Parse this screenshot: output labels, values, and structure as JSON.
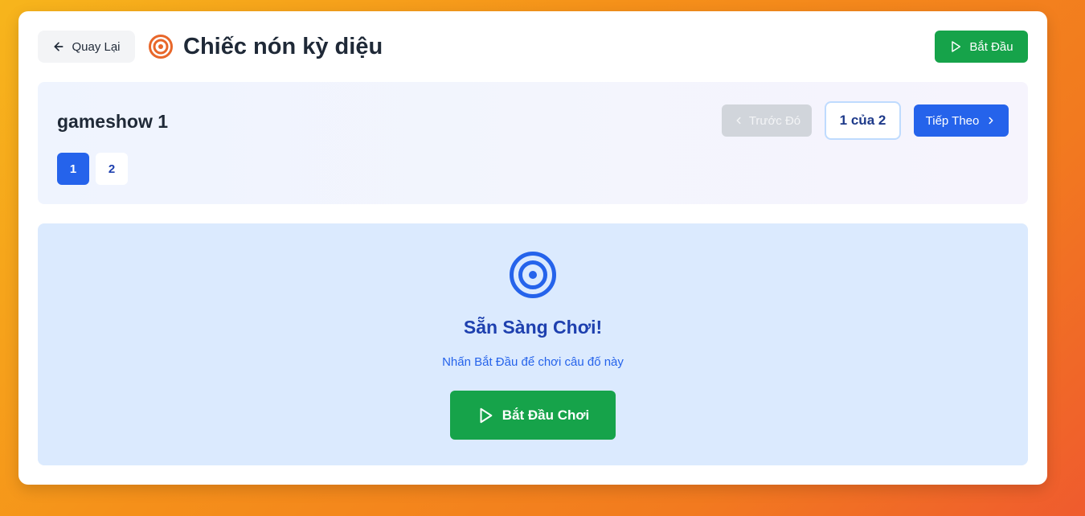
{
  "header": {
    "back_label": "Quay Lại",
    "title": "Chiếc nón kỳ diệu",
    "start_label": "Bắt Đầu"
  },
  "quiz": {
    "name": "gameshow 1",
    "questions": [
      "1",
      "2"
    ],
    "active_question": "1",
    "prev_label": "Trước Đó",
    "page_indicator": "1 của 2",
    "next_label": "Tiếp Theo"
  },
  "ready": {
    "title": "Sẵn Sàng Chơi!",
    "subtitle": "Nhấn Bắt Đầu để chơi câu đố này",
    "button_label": "Bắt Đầu Chơi"
  },
  "icons": {
    "back": "arrow-left-icon",
    "title": "target-icon",
    "start": "play-icon",
    "prev": "chevron-left-icon",
    "next": "chevron-right-icon",
    "ready": "target-icon"
  },
  "colors": {
    "primary": "#2563eb",
    "success": "#16a34a",
    "title_icon": "#e8672a",
    "background_gradient": [
      "#f7b51c",
      "#ef5b2e"
    ]
  }
}
